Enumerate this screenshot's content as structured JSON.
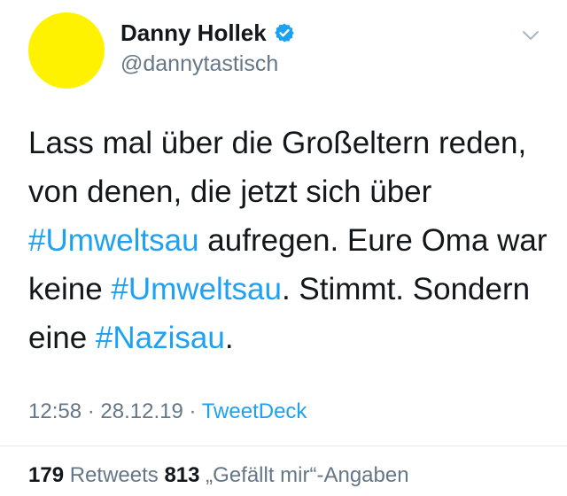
{
  "user": {
    "display_name": "Danny Hollek",
    "handle": "@dannytastisch",
    "avatar_color": "#fff200",
    "verified": true
  },
  "tweet": {
    "segments": [
      {
        "text": "Lass mal über die Großeltern reden, von denen, die jetzt sich über ",
        "type": "text"
      },
      {
        "text": "#Umweltsau",
        "type": "hashtag"
      },
      {
        "text": " aufregen. Eure Oma war keine ",
        "type": "text"
      },
      {
        "text": "#Umweltsau",
        "type": "hashtag"
      },
      {
        "text": ". Stimmt. Sondern eine ",
        "type": "text"
      },
      {
        "text": "#Nazisau",
        "type": "hashtag"
      },
      {
        "text": ".",
        "type": "text"
      }
    ]
  },
  "meta": {
    "time": "12:58",
    "separator1": " · ",
    "date": "28.12.19",
    "separator2": " · ",
    "source": "TweetDeck"
  },
  "stats": {
    "retweets_count": "179",
    "retweets_label": " Retweets ",
    "likes_count": "813",
    "likes_label": " „Gefällt mir“-Angaben"
  },
  "icons": {
    "verified": "verified-badge-icon",
    "menu": "chevron-down-icon"
  },
  "colors": {
    "link": "#1da1f2",
    "secondary": "#657786",
    "primary_text": "#14171a"
  }
}
